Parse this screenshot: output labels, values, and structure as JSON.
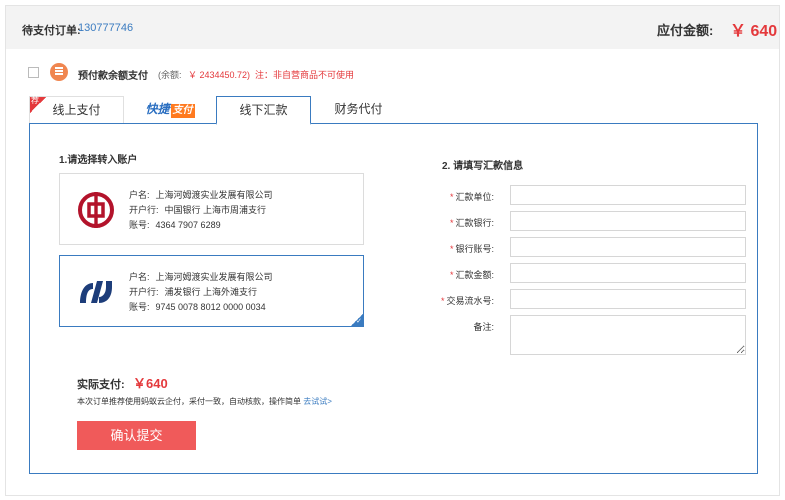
{
  "order": {
    "label": "待支付订单:",
    "number": "130777746",
    "amount_label": "应付金额:",
    "amount_value": "￥ 640"
  },
  "prepay": {
    "title": "预付款余额支付",
    "balance_label": "(余额:",
    "balance_value": "￥ 2434450.72)",
    "note": "注：非自营商品不可使用"
  },
  "tabs": [
    {
      "label": "线上支付"
    },
    {
      "label_a": "快捷",
      "label_b": "支付"
    },
    {
      "label": "线下汇款"
    },
    {
      "label": "财务代付"
    }
  ],
  "recommend_badge": "荐",
  "left": {
    "title": "1.请选择转入账户",
    "accounts": [
      {
        "bank_icon": "boc-logo-icon",
        "name_key": "户名:",
        "name": "上海河姆渡实业发展有限公司",
        "bank_key": "开户行:",
        "bank": "中国银行  上海市周浦支行",
        "account_key": "账号:",
        "account": "4364 7907 6289"
      },
      {
        "bank_icon": "spdb-logo-icon",
        "name_key": "户名:",
        "name": "上海河姆渡实业发展有限公司",
        "bank_key": "开户行:",
        "bank": "浦发银行  上海外滩支行",
        "account_key": "账号:",
        "account": "9745   0078   8012   0000   0034"
      }
    ]
  },
  "right": {
    "title": "2. 请填写汇款信息",
    "fields": [
      {
        "label": "汇款单位:",
        "required": "*",
        "value": ""
      },
      {
        "label": "汇款银行:",
        "required": "*",
        "value": ""
      },
      {
        "label": "银行账号:",
        "required": "*",
        "value": ""
      },
      {
        "label": "汇款金额:",
        "required": "*",
        "value": ""
      },
      {
        "label": "交易流水号:",
        "required": "*",
        "value": ""
      },
      {
        "label": "备注:",
        "required": "",
        "value": ""
      }
    ]
  },
  "summary": {
    "actual_label": "实际支付:",
    "actual_value": "￥640",
    "tip": "本次订单推荐使用蚂蚁云企付，采付一致，自动核款，操作简单 ",
    "tip_link": "去试试>",
    "submit_label": "确认提交"
  },
  "colors": {
    "accent": "#3a7bc0",
    "price": "#e4393c",
    "button": "#f05a5a",
    "boc": "#b3132b",
    "spdb": "#1d3d7a"
  }
}
